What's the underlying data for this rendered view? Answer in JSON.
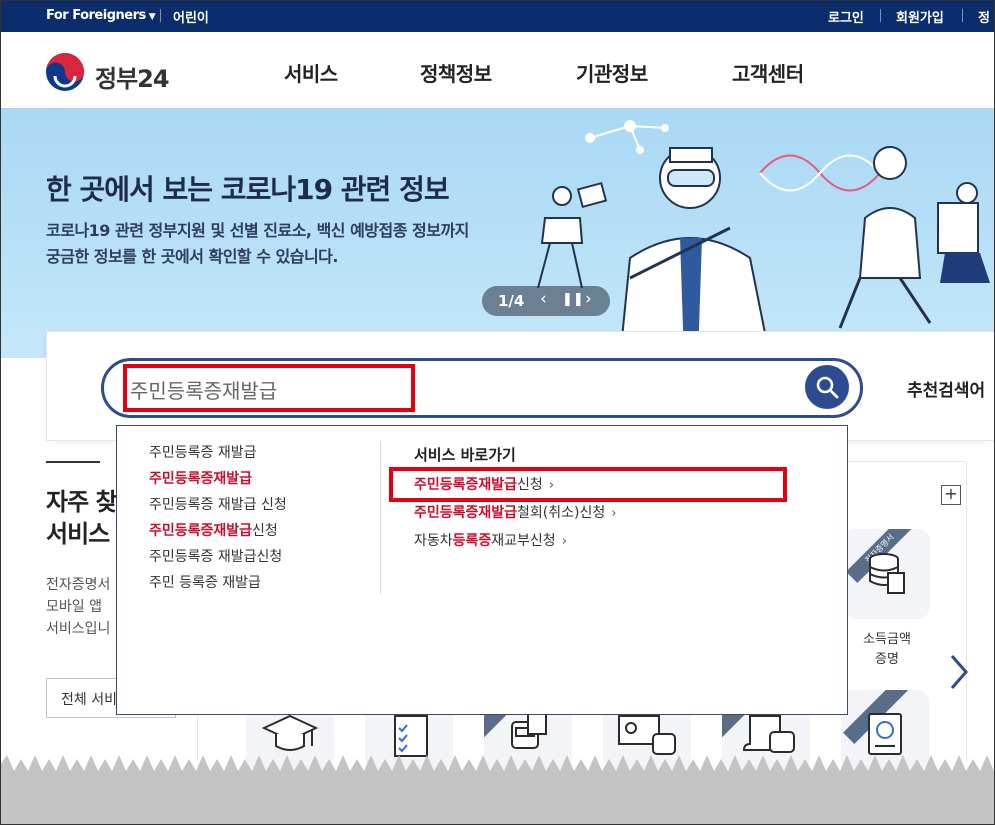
{
  "topbar": {
    "language": "For Foreigners",
    "kids": "어린이",
    "login": "로그인",
    "signup": "회원가입",
    "more": "정"
  },
  "header": {
    "logo_text": "정부24",
    "nav": [
      "서비스",
      "정책정보",
      "기관정보",
      "고객센터"
    ]
  },
  "banner": {
    "title": "한 곳에서 보는 코로나19 관련 정보",
    "desc_line1": "코로나19 관련 정부지원 및 선별 진료소, 백신 예방접종 정보까지",
    "desc_line2": "궁금한 정보를 한 곳에서 확인할 수 있습니다.",
    "pager": "1/4"
  },
  "search": {
    "value": "주민등록증재발급",
    "recommend_label": "추천검색어"
  },
  "autocomplete": {
    "suggestions": [
      {
        "pre": "주민등록증 재발급",
        "hl": "",
        "post": ""
      },
      {
        "pre": "",
        "hl": "주민등록증재발급",
        "post": ""
      },
      {
        "pre": "주민등록증 재발급 신청",
        "hl": "",
        "post": ""
      },
      {
        "pre": "",
        "hl": "주민등록증재발급",
        "post": "신청"
      },
      {
        "pre": "주민등록증 재발급신청",
        "hl": "",
        "post": ""
      },
      {
        "pre": "주민 등록증 재발급",
        "hl": "",
        "post": ""
      }
    ],
    "service_title": "서비스 바로가기",
    "services": [
      {
        "pre": "",
        "hl": "주민등록증재발급",
        "post": "신청"
      },
      {
        "pre": "",
        "hl": "주민등록증재발급",
        "post": "철회(취소)신청"
      },
      {
        "pre": "자동차",
        "hl": "등록증",
        "post": "재교부신청"
      }
    ]
  },
  "favorites": {
    "title_line1": "자주 찾",
    "title_line2": "서비스",
    "desc_line1": "전자증명서",
    "desc_line2": "모바일 앱",
    "desc_line3": "서비스입니",
    "all_button": "전체 서비",
    "tile_income_line1": "소득금액",
    "tile_income_line2": "증명",
    "ribbon": "전자증명서"
  },
  "colors": {
    "topbar": "#0b2d6b",
    "primary": "#2c4b91",
    "highlight_red": "#e3000f",
    "match_text": "#c8102e"
  }
}
